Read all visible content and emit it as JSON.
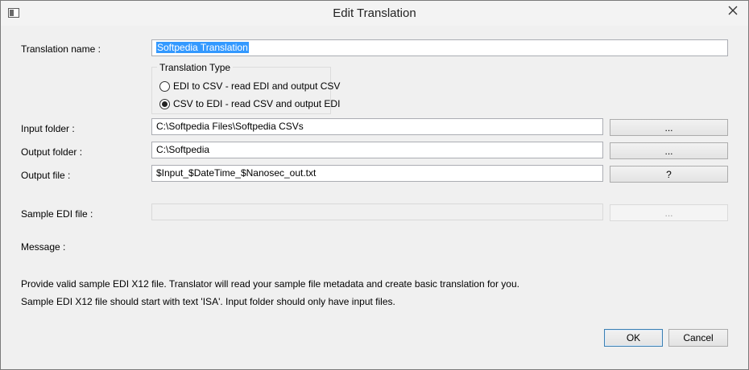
{
  "window": {
    "title": "Edit Translation"
  },
  "form": {
    "translation_name_label": "Translation name :",
    "translation_name_value": "Softpedia Translation",
    "translation_type_legend": "Translation Type",
    "radio_edi_to_csv": "EDI to CSV - read EDI and output CSV",
    "radio_csv_to_edi": "CSV to EDI - read CSV and output EDI",
    "input_folder_label": "Input folder :",
    "input_folder_value": "C:\\Softpedia Files\\Softpedia CSVs",
    "input_folder_browse": "...",
    "output_folder_label": "Output folder :",
    "output_folder_value": "C:\\Softpedia",
    "output_folder_browse": "...",
    "output_file_label": "Output file :",
    "output_file_value": "$Input_$DateTime_$Nanosec_out.txt",
    "output_file_help": "?",
    "sample_edi_label": "Sample EDI file :",
    "sample_edi_value": "",
    "sample_edi_browse": "...",
    "message_label": "Message :",
    "info_line1": "Provide valid sample EDI X12 file. Translator will read your sample file metadata and create basic translation for you.",
    "info_line2": "Sample EDI X12 file should start with text 'ISA'. Input folder should only have input files."
  },
  "buttons": {
    "ok": "OK",
    "cancel": "Cancel"
  }
}
